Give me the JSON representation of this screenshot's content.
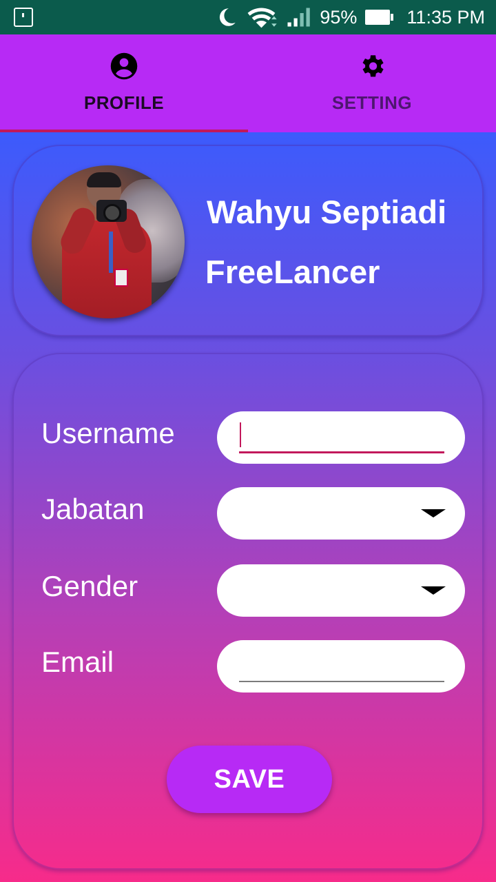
{
  "status_bar": {
    "battery": "95%",
    "time": "11:35 PM"
  },
  "tabs": [
    {
      "label": "PROFILE",
      "icon": "account-circle-icon",
      "active": true
    },
    {
      "label": "SETTING",
      "icon": "gear-icon",
      "active": false
    }
  ],
  "profile": {
    "name": "Wahyu Septiadi",
    "role": "FreeLancer"
  },
  "form": {
    "username": {
      "label": "Username",
      "value": ""
    },
    "jabatan": {
      "label": "Jabatan",
      "value": ""
    },
    "gender": {
      "label": "Gender",
      "value": ""
    },
    "email": {
      "label": "Email",
      "value": ""
    },
    "save_label": "SAVE"
  },
  "colors": {
    "status_bar": "#0b5b4c",
    "tab_bar": "#b72af5",
    "tab_indicator": "#c2185b",
    "gradient_top": "#3c5bfc",
    "gradient_bottom": "#f72b8a",
    "save_button": "#b72af5"
  }
}
